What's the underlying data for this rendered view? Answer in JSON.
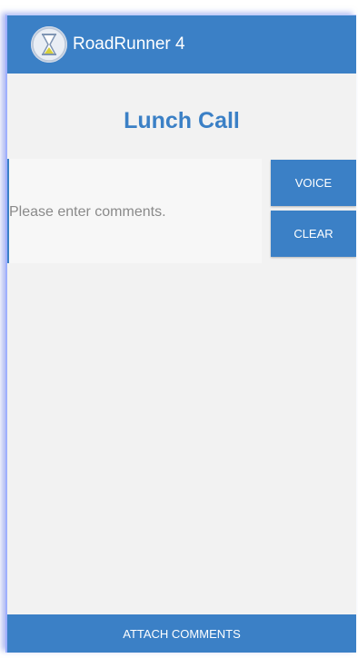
{
  "appbar": {
    "title": "RoadRunner 4",
    "icon": "hourglass-icon"
  },
  "main": {
    "heading": "Lunch Call",
    "comments": {
      "placeholder": "Please enter comments.",
      "value": ""
    },
    "voice_label": "VOICE",
    "clear_label": "CLEAR"
  },
  "footer": {
    "attach_label": "ATTACH COMMENTS"
  },
  "colors": {
    "primary": "#3b80c6",
    "background": "#f2f2f2"
  }
}
